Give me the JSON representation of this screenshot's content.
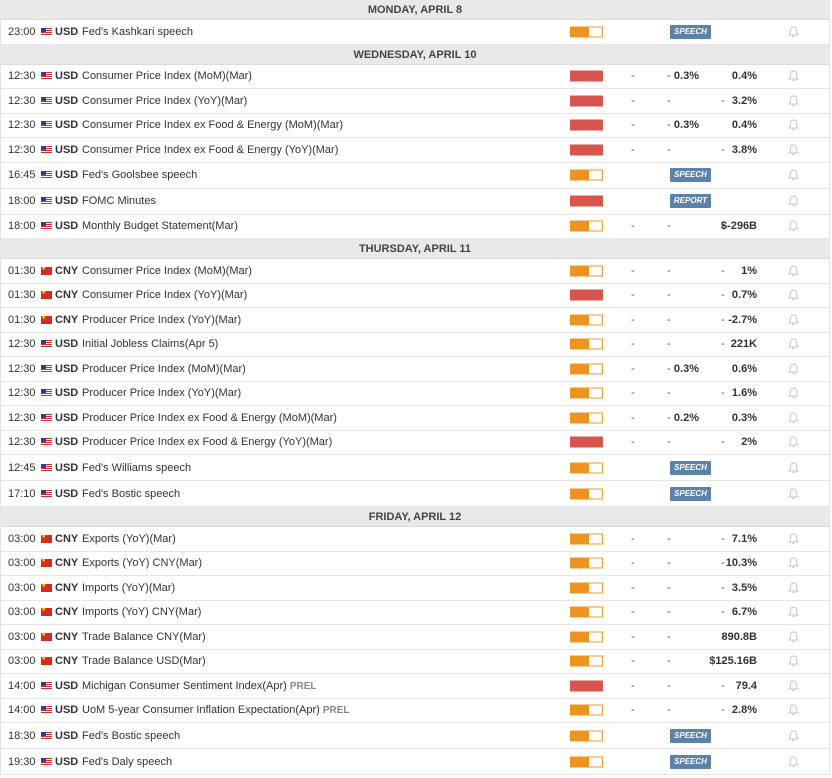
{
  "colors": {
    "medium": "#f0921f",
    "high": "#d9534f",
    "badge": "#5b82a8"
  },
  "days": [
    {
      "label": "MONDAY, APRIL 8",
      "events": [
        {
          "time": "23:00",
          "flag": "us",
          "currency": "USD",
          "name": "Fed's Kashkari speech",
          "impact": "medium",
          "badge": "SPEECH",
          "bell": "bell-icon"
        }
      ]
    },
    {
      "label": "WEDNESDAY, APRIL 10",
      "events": [
        {
          "time": "12:30",
          "flag": "us",
          "currency": "USD",
          "name": "Consumer Price Index (MoM)(Mar)",
          "impact": "high",
          "dash1": "-",
          "dash2": "-",
          "consensus": "0.3%",
          "previous": "0.4%",
          "bell": "bell-icon"
        },
        {
          "time": "12:30",
          "flag": "us",
          "currency": "USD",
          "name": "Consumer Price Index (YoY)(Mar)",
          "impact": "high",
          "dash1": "-",
          "dash2": "-",
          "dash3": "-",
          "previous": "3.2%",
          "bell": "bell-icon"
        },
        {
          "time": "12:30",
          "flag": "us",
          "currency": "USD",
          "name": "Consumer Price Index ex Food & Energy (MoM)(Mar)",
          "impact": "high",
          "dash1": "-",
          "dash2": "-",
          "consensus": "0.3%",
          "previous": "0.4%",
          "bell": "bell-icon"
        },
        {
          "time": "12:30",
          "flag": "us",
          "currency": "USD",
          "name": "Consumer Price Index ex Food & Energy (YoY)(Mar)",
          "impact": "high",
          "dash1": "-",
          "dash2": "-",
          "dash3": "-",
          "previous": "3.8%",
          "bell": "bell-icon"
        },
        {
          "time": "16:45",
          "flag": "us",
          "currency": "USD",
          "name": "Fed's Goolsbee speech",
          "impact": "medium",
          "badge": "SPEECH",
          "tall": true,
          "bell": "bell-icon"
        },
        {
          "time": "18:00",
          "flag": "us",
          "currency": "USD",
          "name": "FOMC Minutes",
          "impact": "high",
          "badge": "REPORT",
          "tall": true,
          "bell": "bell-icon"
        },
        {
          "time": "18:00",
          "flag": "us",
          "currency": "USD",
          "name": "Monthly Budget Statement(Mar)",
          "impact": "medium",
          "dash1": "-",
          "dash2": "-",
          "dash3": "-",
          "previous": "$-296B",
          "bell": "bell-icon"
        }
      ]
    },
    {
      "label": "THURSDAY, APRIL 11",
      "events": [
        {
          "time": "01:30",
          "flag": "cn",
          "currency": "CNY",
          "name": "Consumer Price Index (MoM)(Mar)",
          "impact": "medium",
          "dash1": "-",
          "dash2": "-",
          "dash3": "-",
          "previous": "1%",
          "bell": "bell-icon"
        },
        {
          "time": "01:30",
          "flag": "cn",
          "currency": "CNY",
          "name": "Consumer Price Index (YoY)(Mar)",
          "impact": "high",
          "dash1": "-",
          "dash2": "-",
          "dash3": "-",
          "previous": "0.7%",
          "bell": "bell-icon"
        },
        {
          "time": "01:30",
          "flag": "cn",
          "currency": "CNY",
          "name": "Producer Price Index (YoY)(Mar)",
          "impact": "medium",
          "dash1": "-",
          "dash2": "-",
          "dash3": "-",
          "previous": "-2.7%",
          "bell": "bell-icon"
        },
        {
          "time": "12:30",
          "flag": "us",
          "currency": "USD",
          "name": "Initial Jobless Claims(Apr 5)",
          "impact": "medium",
          "dash1": "-",
          "dash2": "-",
          "dash3": "-",
          "previous": "221K",
          "bell": "bell-icon"
        },
        {
          "time": "12:30",
          "flag": "us",
          "currency": "USD",
          "name": "Producer Price Index (MoM)(Mar)",
          "impact": "medium",
          "dash1": "-",
          "dash2": "-",
          "consensus": "0.3%",
          "previous": "0.6%",
          "bell": "bell-icon"
        },
        {
          "time": "12:30",
          "flag": "us",
          "currency": "USD",
          "name": "Producer Price Index (YoY)(Mar)",
          "impact": "medium",
          "dash1": "-",
          "dash2": "-",
          "dash3": "-",
          "previous": "1.6%",
          "bell": "bell-icon"
        },
        {
          "time": "12:30",
          "flag": "us",
          "currency": "USD",
          "name": "Producer Price Index ex Food & Energy (MoM)(Mar)",
          "impact": "medium",
          "dash1": "-",
          "dash2": "-",
          "consensus": "0.2%",
          "previous": "0.3%",
          "bell": "bell-icon"
        },
        {
          "time": "12:30",
          "flag": "us",
          "currency": "USD",
          "name": "Producer Price Index ex Food & Energy (YoY)(Mar)",
          "impact": "high",
          "dash1": "-",
          "dash2": "-",
          "dash3": "-",
          "previous": "2%",
          "bell": "bell-icon"
        },
        {
          "time": "12:45",
          "flag": "us",
          "currency": "USD",
          "name": "Fed's Williams speech",
          "impact": "medium",
          "badge": "SPEECH",
          "tall": true,
          "bell": "bell-icon"
        },
        {
          "time": "17:10",
          "flag": "us",
          "currency": "USD",
          "name": "Fed's Bostic speech",
          "impact": "medium",
          "badge": "SPEECH",
          "tall": true,
          "bell": "bell-icon"
        }
      ]
    },
    {
      "label": "FRIDAY, APRIL 12",
      "events": [
        {
          "time": "03:00",
          "flag": "cn",
          "currency": "CNY",
          "name": "Exports (YoY)(Mar)",
          "impact": "medium",
          "dash1": "-",
          "dash2": "-",
          "dash3": "-",
          "previous": "7.1%",
          "bell": "bell-icon"
        },
        {
          "time": "03:00",
          "flag": "cn",
          "currency": "CNY",
          "name": "Exports (YoY) CNY(Mar)",
          "impact": "medium",
          "dash1": "-",
          "dash2": "-",
          "dash3": "-",
          "previous": "10.3%",
          "bell": "bell-icon"
        },
        {
          "time": "03:00",
          "flag": "cn",
          "currency": "CNY",
          "name": "Imports (YoY)(Mar)",
          "impact": "medium",
          "dash1": "-",
          "dash2": "-",
          "dash3": "-",
          "previous": "3.5%",
          "bell": "bell-icon"
        },
        {
          "time": "03:00",
          "flag": "cn",
          "currency": "CNY",
          "name": "Imports (YoY) CNY(Mar)",
          "impact": "medium",
          "dash1": "-",
          "dash2": "-",
          "dash3": "-",
          "previous": "6.7%",
          "bell": "bell-icon"
        },
        {
          "time": "03:00",
          "flag": "cn",
          "currency": "CNY",
          "name": "Trade Balance CNY(Mar)",
          "impact": "medium",
          "dash1": "-",
          "dash2": "-",
          "dash3": "-",
          "previous": "890.8B",
          "bell": "bell-icon"
        },
        {
          "time": "03:00",
          "flag": "cn",
          "currency": "CNY",
          "name": "Trade Balance USD(Mar)",
          "impact": "medium",
          "dash1": "-",
          "dash2": "-",
          "dash3": "-",
          "previous": "$125.16B",
          "bell": "bell-icon"
        },
        {
          "time": "14:00",
          "flag": "us",
          "currency": "USD",
          "name": "Michigan Consumer Sentiment Index(Apr)",
          "tag": "PREL",
          "impact": "high",
          "dash1": "-",
          "dash2": "-",
          "dash3": "-",
          "previous": "79.4",
          "bell": "bell-icon"
        },
        {
          "time": "14:00",
          "flag": "us",
          "currency": "USD",
          "name": "UoM 5-year Consumer Inflation Expectation(Apr)",
          "tag": "PREL",
          "impact": "medium",
          "dash1": "-",
          "dash2": "-",
          "dash3": "-",
          "previous": "2.8%",
          "bell": "bell-icon"
        },
        {
          "time": "18:30",
          "flag": "us",
          "currency": "USD",
          "name": "Fed's Bostic speech",
          "impact": "medium",
          "badge": "SPEECH",
          "tall": true,
          "bell": "bell-icon"
        },
        {
          "time": "19:30",
          "flag": "us",
          "currency": "USD",
          "name": "Fed's Daly speech",
          "impact": "medium",
          "badge": "SPEECH",
          "tall": true,
          "bell": "bell-icon"
        }
      ]
    }
  ]
}
